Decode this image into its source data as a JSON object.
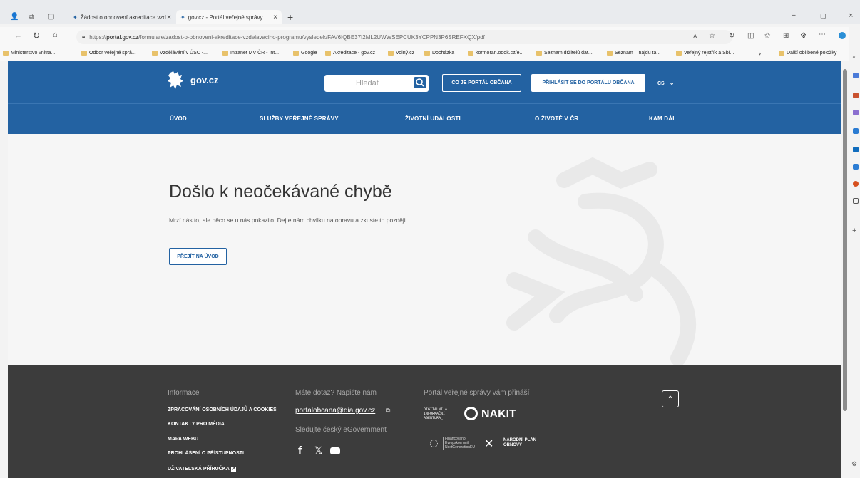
{
  "browser": {
    "tabs": [
      {
        "label": "Žádost o obnovení akreditace vzd"
      },
      {
        "label": "gov.cz - Portál veřejné správy"
      }
    ],
    "url_prefix": "https://",
    "url_host": "portal.gov.cz",
    "url_path": "/formulare/zadost-o-obnoveni-akreditace-vzdelavaciho-programu/vysledek/FAV6IQBE37I2ML2UWWSEPCUK3YCPPN3P6SREFXQX/pdf",
    "read_aloud": "A",
    "bookmarks": [
      "Ministerstvo vnitra...",
      "Odbor veřejné sprá...",
      "Vzdělávání v ÚSC -...",
      "Intranet MV ČR - Int...",
      "Google",
      "Akreditace - gov.cz",
      "Volný.cz",
      "Docházka",
      "kormoran.odok.cz/e...",
      "Seznam držitelů dat...",
      "Seznam – najdu ta...",
      "Veřejný rejstřík a Sbí...",
      "Další oblíbené položky"
    ]
  },
  "header": {
    "logo": "gov.cz",
    "search_placeholder": "Hledat",
    "about_btn": "CO JE PORTÁL OBČANA",
    "login_btn": "PŘIHLÁSIT SE DO PORTÁLU OBČANA",
    "lang": "CS"
  },
  "nav": [
    "ÚVOD",
    "SLUŽBY VEŘEJNÉ SPRÁVY",
    "ŽIVOTNÍ UDÁLOSTI",
    "O ŽIVOTĚ V ČR",
    "KAM DÁL"
  ],
  "error": {
    "title": "Došlo k neočekávané chybě",
    "message": "Mrzí nás to, ale něco se u nás pokazilo. Dejte nám chvilku na opravu a zkuste to později.",
    "home_btn": "PŘEJÍT NA ÚVOD"
  },
  "footer": {
    "info_heading": "Informace",
    "links": [
      "ZPRACOVÁNÍ OSOBNÍCH ÚDAJŮ A COOKIES",
      "KONTAKTY PRO MÉDIA",
      "MAPA WEBU",
      "PROHLÁŠENÍ O PŘÍSTUPNOSTI",
      "UŽIVATELSKÁ PŘÍRUČKA"
    ],
    "contact_heading": "Máte dotaz? Napište nám",
    "email": "portalobcana@dia.gov.cz",
    "social_heading": "Sledujte český eGovernment",
    "brought_heading": "Portál veřejné správy vám přináší",
    "dia": "DIGITÁLNÍ A INFORMAČNÍ AGENTURA_",
    "nakit": "NAKIT",
    "eu": "Financováno Evropskou unií NextGenerationEU",
    "npo": "NÁRODNÍ PLÁN OBNOVY"
  }
}
